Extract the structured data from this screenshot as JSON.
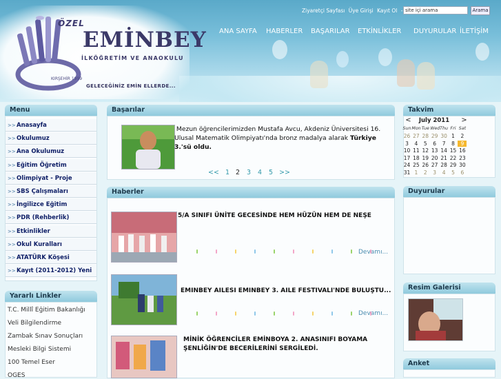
{
  "header": {
    "logo_ozel": "ÖZEL",
    "logo_name": "EMİNBEY",
    "logo_sub": "İLKÖĞRETİM VE ANAOKULU",
    "logo_year": "KIRŞEHİR 1999",
    "slogan": "GELECEĞİNİZ EMİN ELLERDE...",
    "top_links": [
      "Ziyaretçi Sayfası",
      "Üye Girişi",
      "Kayıt Ol",
      "-",
      "+"
    ],
    "search_placeholder": "site içi arama",
    "search_button": "Arama"
  },
  "nav": [
    "ANA SAYFA",
    "HABERLER",
    "BAŞARILAR",
    "ETKİNLİKLER",
    "DUYURULAR",
    "İLETİŞİM"
  ],
  "menu": {
    "title": "Menu",
    "items": [
      "Anasayfa",
      "Okulumuz",
      "Ana Okulumuz",
      "Eğitim Öğretim",
      "Olimpiyat - Proje",
      "SBS Çalışmaları",
      "İngilizce Eğitim",
      "PDR (Rehberlik)",
      "Etkinlikler",
      "Okul Kuralları",
      "ATATÜRK Köşesi",
      "Kayıt (2011-2012) Yeni"
    ]
  },
  "useful_links": {
    "title": "Yararlı Linkler",
    "items": [
      "T.C. Millî Eğitim Bakanlığı",
      "Veli Bilgilendirme",
      "Zambak Sınav Sonuçları",
      "Mesleki Bilgi Sistemi",
      "100 Temel Eser",
      "OGES"
    ]
  },
  "achievements": {
    "title": "Başarılar",
    "text": "Mezun öğrencilerimizden Mustafa Avcu, Akdeniz Üniversitesi 16. Ulusal Matematik Olimpiyatı'nda bronz madalya alarak",
    "bold": "Türkiye 3.'sü oldu.",
    "pager": [
      "<<",
      "1",
      "2",
      "3",
      "4",
      "5",
      ">>"
    ],
    "current_page": "2"
  },
  "news": {
    "title": "Haberler",
    "more_label": "Devamı...",
    "items": [
      {
        "title": "5/A SINIFI ÜNİTE GECESİNDE HEM HÜZÜN HEM DE NEŞE"
      },
      {
        "title": "EMİNBEY AİLESİ EMİNBEY 3. AİLE FESTİVALİ'NDE BULUŞTU..."
      },
      {
        "title": "MİNİK ÖĞRENCİLER EMİNBOYA 2. ANASINIFI BOYAMA ŞENLİĞİN'DE BECERİLERİNİ SERGİLEDİ."
      }
    ]
  },
  "calendar": {
    "title": "Takvim",
    "prev": "<",
    "next": ">",
    "month": "July 2011",
    "days": [
      "Sun",
      "Mon",
      "Tue",
      "Wed",
      "Thu",
      "Fri",
      "Sat"
    ],
    "weeks": [
      [
        "26",
        "27",
        "28",
        "29",
        "30",
        "1",
        "2"
      ],
      [
        "3",
        "4",
        "5",
        "6",
        "7",
        "8",
        "9"
      ],
      [
        "10",
        "11",
        "12",
        "13",
        "14",
        "15",
        "16"
      ],
      [
        "17",
        "18",
        "19",
        "20",
        "21",
        "22",
        "23"
      ],
      [
        "24",
        "25",
        "26",
        "27",
        "28",
        "29",
        "30"
      ],
      [
        "31",
        "1",
        "2",
        "3",
        "4",
        "5",
        "6"
      ]
    ],
    "today": "9"
  },
  "announcements": {
    "title": "Duyurular"
  },
  "gallery": {
    "title": "Resim Galerisi"
  },
  "poll": {
    "title": "Anket"
  },
  "colors": {
    "header": "#79bfda",
    "panel_title": "#8fcadd",
    "menu_text": "#0e1e66",
    "today": "#f5b82e",
    "link": "#4b8db0"
  }
}
